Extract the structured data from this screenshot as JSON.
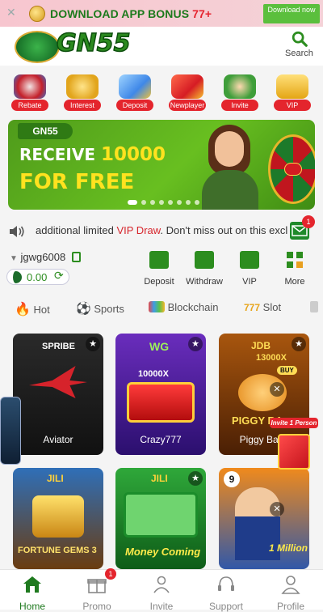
{
  "topbanner": {
    "text_main": "DOWNLOAD APP BONUS",
    "text_bonus": "77+",
    "button": "Download now"
  },
  "header": {
    "logo_text": "GN55",
    "search_label": "Search"
  },
  "categories": [
    {
      "label": "Rebate"
    },
    {
      "label": "Interest"
    },
    {
      "label": "Deposit"
    },
    {
      "label": "Newplayer"
    },
    {
      "label": "Invite"
    },
    {
      "label": "VIP"
    }
  ],
  "hero": {
    "tag": "GN55",
    "line1_a": "RECEIVE",
    "line1_b": "10000",
    "line2": "FOR FREE"
  },
  "marquee": {
    "text_a": "additional limited",
    "text_vip": "VIP Draw",
    "text_b": ". Don't miss out on this exclu",
    "mail_badge": "1"
  },
  "account": {
    "username": "jgwg6008",
    "balance": "0.00"
  },
  "actions": [
    {
      "label": "Deposit"
    },
    {
      "label": "Withdraw"
    },
    {
      "label": "VIP"
    },
    {
      "label": "More"
    }
  ],
  "tabs": [
    {
      "label": "Hot"
    },
    {
      "label": "Sports"
    },
    {
      "label": "Blockchain"
    },
    {
      "label": "Slot"
    }
  ],
  "games": [
    {
      "name": "Aviator",
      "provider": "SPRIBE"
    },
    {
      "name": "Crazy777",
      "provider": "WG"
    },
    {
      "name": "Piggy Bank",
      "provider": "JDB"
    },
    {
      "name": "",
      "provider": "JILI",
      "art_text": "FORTUNE GEMS 3"
    },
    {
      "name": "",
      "provider": "JILI",
      "art_text": "Money Coming"
    },
    {
      "name": "",
      "provider": "9",
      "art_text": "1 Million"
    }
  ],
  "game_art": {
    "crazy_multiplier": "10000X",
    "piggy_multiplier": "13000X",
    "piggy_buy": "BUY",
    "piggy_title": "PIGGY BA",
    "invite_promo": "Invite 1 Person"
  },
  "bottom_nav": [
    {
      "label": "Home"
    },
    {
      "label": "Promo",
      "badge": "1"
    },
    {
      "label": "Invite"
    },
    {
      "label": "Support"
    },
    {
      "label": "Profile"
    }
  ],
  "colors": {
    "brand_green": "#2c8d1f",
    "accent_red": "#e4252d",
    "bonus_yellow": "#ffe21f"
  }
}
